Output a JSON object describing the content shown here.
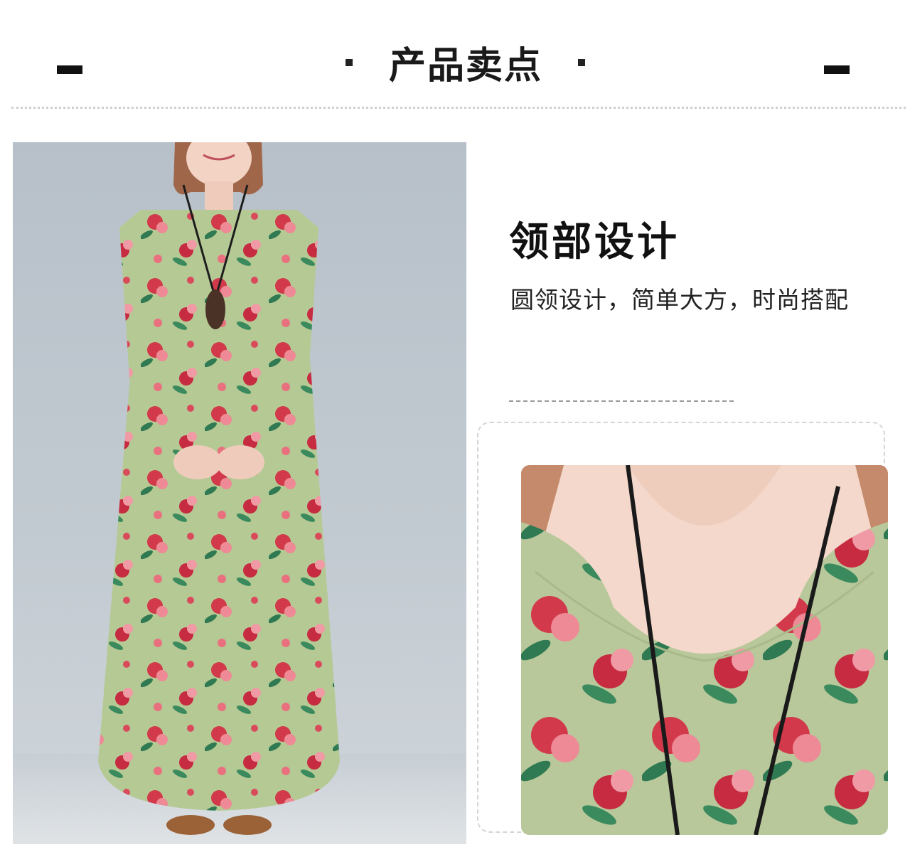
{
  "header": {
    "title": "产品卖点"
  },
  "feature": {
    "heading": "领部设计",
    "description": "圆领设计，简单大方，时尚搭配"
  },
  "images": {
    "main_photo": "floral-maxi-dress-model-photo",
    "detail_photo": "neckline-closeup-photo"
  },
  "colors": {
    "dress_green": "#b5c994",
    "flower_red": "#d23a4c",
    "flower_pink": "#ee8a96",
    "leaf_green": "#2f7a52",
    "backdrop": "#bfc7ce",
    "skin": "#f2d3c4"
  }
}
